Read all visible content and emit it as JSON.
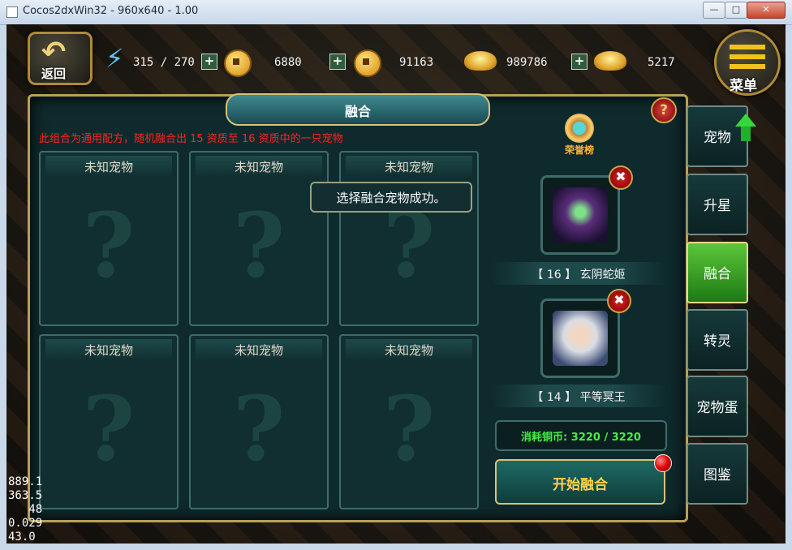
{
  "window": {
    "title": "Cocos2dxWin32 - 960x640 - 1.00",
    "min_glyph": "—",
    "max_glyph": "□",
    "close_glyph": "✕"
  },
  "topbar": {
    "back_label": "返回",
    "back_arrow": "↶",
    "energy_icon": "⚡",
    "energy": "315 / 270",
    "plus": "+",
    "copper": "6880",
    "silver": "91163",
    "gold": "989786",
    "gold_locked": "5217",
    "menu_label": "菜单"
  },
  "panel": {
    "title": "融合",
    "help": "?",
    "hint": "此组合为通用配方，随机融合出 15 资质至 16 资质中的一只宠物",
    "slots": [
      {
        "label": "未知宠物",
        "mark": "?"
      },
      {
        "label": "未知宠物",
        "mark": "?"
      },
      {
        "label": "未知宠物",
        "mark": "?"
      },
      {
        "label": "未知宠物",
        "mark": "?"
      },
      {
        "label": "未知宠物",
        "mark": "?"
      },
      {
        "label": "未知宠物",
        "mark": "?"
      }
    ],
    "toast": "选择融合宠物成功。",
    "honor_label": "荣誉榜",
    "remove_glyph": "✖",
    "pet1": "【  16  】 玄阴蛇姬",
    "pet2": "【  14  】 平等冥王",
    "cost": "消耗铜币: 3220 / 3220",
    "start": "开始融合"
  },
  "tabs": [
    {
      "label": "宠物",
      "active": false
    },
    {
      "label": "升星",
      "active": false
    },
    {
      "label": "融合",
      "active": true
    },
    {
      "label": "转灵",
      "active": false
    },
    {
      "label": "宠物蛋",
      "active": false
    },
    {
      "label": "图鉴",
      "active": false
    }
  ],
  "debug_stats": "889.1\n363.5\n   48\n0.029\n43.0"
}
